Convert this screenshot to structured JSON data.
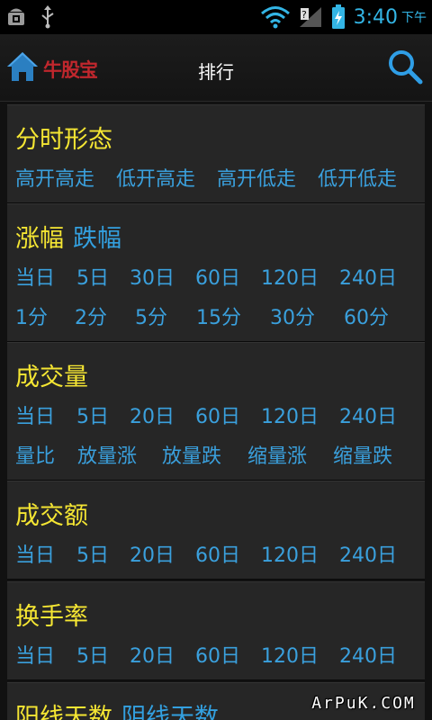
{
  "status_bar": {
    "time": "3:40",
    "ampm": "下午"
  },
  "header": {
    "logo": "牛股宝",
    "title": "排行"
  },
  "sections": [
    {
      "title": "分时形态",
      "rows": [
        [
          "高开高走",
          "低开高走",
          "高开低走",
          "低开低走"
        ]
      ]
    },
    {
      "title": "涨幅",
      "title_alt": "跌幅",
      "rows": [
        [
          "当日",
          "5日",
          "30日",
          "60日",
          "120日",
          "240日"
        ],
        [
          "1分",
          "2分",
          "5分",
          "15分",
          "30分",
          "60分"
        ]
      ]
    },
    {
      "title": "成交量",
      "rows": [
        [
          "当日",
          "5日",
          "20日",
          "60日",
          "120日",
          "240日"
        ],
        [
          "量比",
          "放量涨",
          "放量跌",
          "缩量涨",
          "缩量跌"
        ]
      ]
    },
    {
      "title": "成交额",
      "rows": [
        [
          "当日",
          "5日",
          "20日",
          "60日",
          "120日",
          "240日"
        ]
      ]
    },
    {
      "title": "换手率",
      "rows": [
        [
          "当日",
          "5日",
          "20日",
          "60日",
          "120日",
          "240日"
        ]
      ]
    },
    {
      "title": "阳线天数",
      "title_alt": "阴线天数",
      "rows": []
    }
  ],
  "watermark": "ArPuK.COM",
  "colors": {
    "accent": "#33b5e5",
    "title_yellow": "#f5e633",
    "link_blue": "#3aa0dd",
    "logo_red": "#c0272d"
  }
}
